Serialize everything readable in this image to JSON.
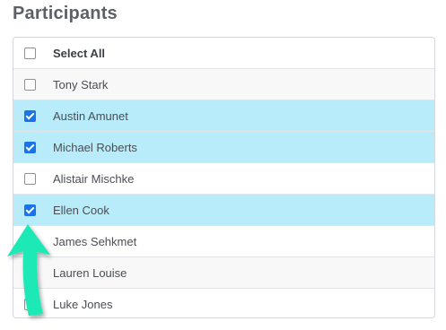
{
  "title": "Participants",
  "select_all": {
    "label": "Select All",
    "checked": false
  },
  "participants": [
    {
      "name": "Tony Stark",
      "checked": false
    },
    {
      "name": "Austin Amunet",
      "checked": true
    },
    {
      "name": "Michael Roberts",
      "checked": true
    },
    {
      "name": "Alistair Mischke",
      "checked": false
    },
    {
      "name": "Ellen Cook",
      "checked": true
    },
    {
      "name": "James Sehkmet",
      "checked": false
    },
    {
      "name": "Lauren Louise",
      "checked": false
    },
    {
      "name": "Luke Jones",
      "checked": false
    }
  ],
  "colors": {
    "checked_row": "#b8ecfa",
    "checkbox_checked": "#1a73e8",
    "arrow": "#1de9b6"
  },
  "annotation": {
    "icon": "up-arrow-icon"
  }
}
